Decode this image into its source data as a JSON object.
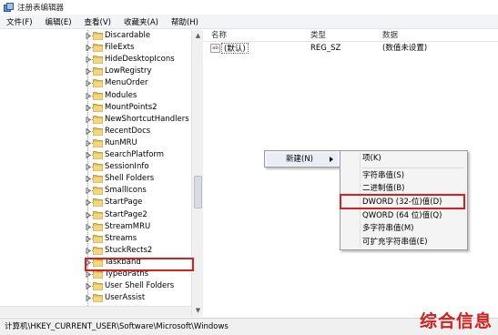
{
  "window": {
    "title": "注册表编辑器",
    "app_icon": "regedit-icon"
  },
  "menu": [
    "文件(F)",
    "编辑(E)",
    "查看(V)",
    "收藏夹(A)",
    "帮助(H)"
  ],
  "tree": {
    "items": [
      "Discardable",
      "FileExts",
      "HideDesktopIcons",
      "LowRegistry",
      "MenuOrder",
      "Modules",
      "MountPoints2",
      "NewShortcutHandlers",
      "RecentDocs",
      "RunMRU",
      "SearchPlatform",
      "SessionInfo",
      "Shell Folders",
      "SmallIcons",
      "StartPage",
      "StartPage2",
      "StreamMRU",
      "Streams",
      "StuckRects2",
      "Taskband",
      "TypedPaths",
      "User Shell Folders",
      "UserAssist"
    ],
    "selected": "Taskband"
  },
  "values": {
    "columns": {
      "name": "名称",
      "type": "类型",
      "data": "数据"
    },
    "rows": [
      {
        "icon": "ab",
        "name": "(默认)",
        "type": "REG_SZ",
        "data": "(数值未设置)"
      }
    ]
  },
  "context_menu": {
    "new_label": "新建(N)",
    "submenu": [
      "项(K)",
      "字符串值(S)",
      "二进制值(B)",
      "DWORD (32-位)值(D)",
      "QWORD (64 位)值(Q)",
      "多字符串值(M)",
      "可扩充字符串值(E)"
    ],
    "highlighted": "DWORD (32-位)值(D)"
  },
  "status": {
    "path": "计算机\\HKEY_CURRENT_USER\\Software\\Microsoft\\Windows"
  },
  "watermark": "综合信息",
  "colors": {
    "highlight_box": "#d62020",
    "folder": "#e8c15a",
    "watermark": "#d2201e"
  }
}
